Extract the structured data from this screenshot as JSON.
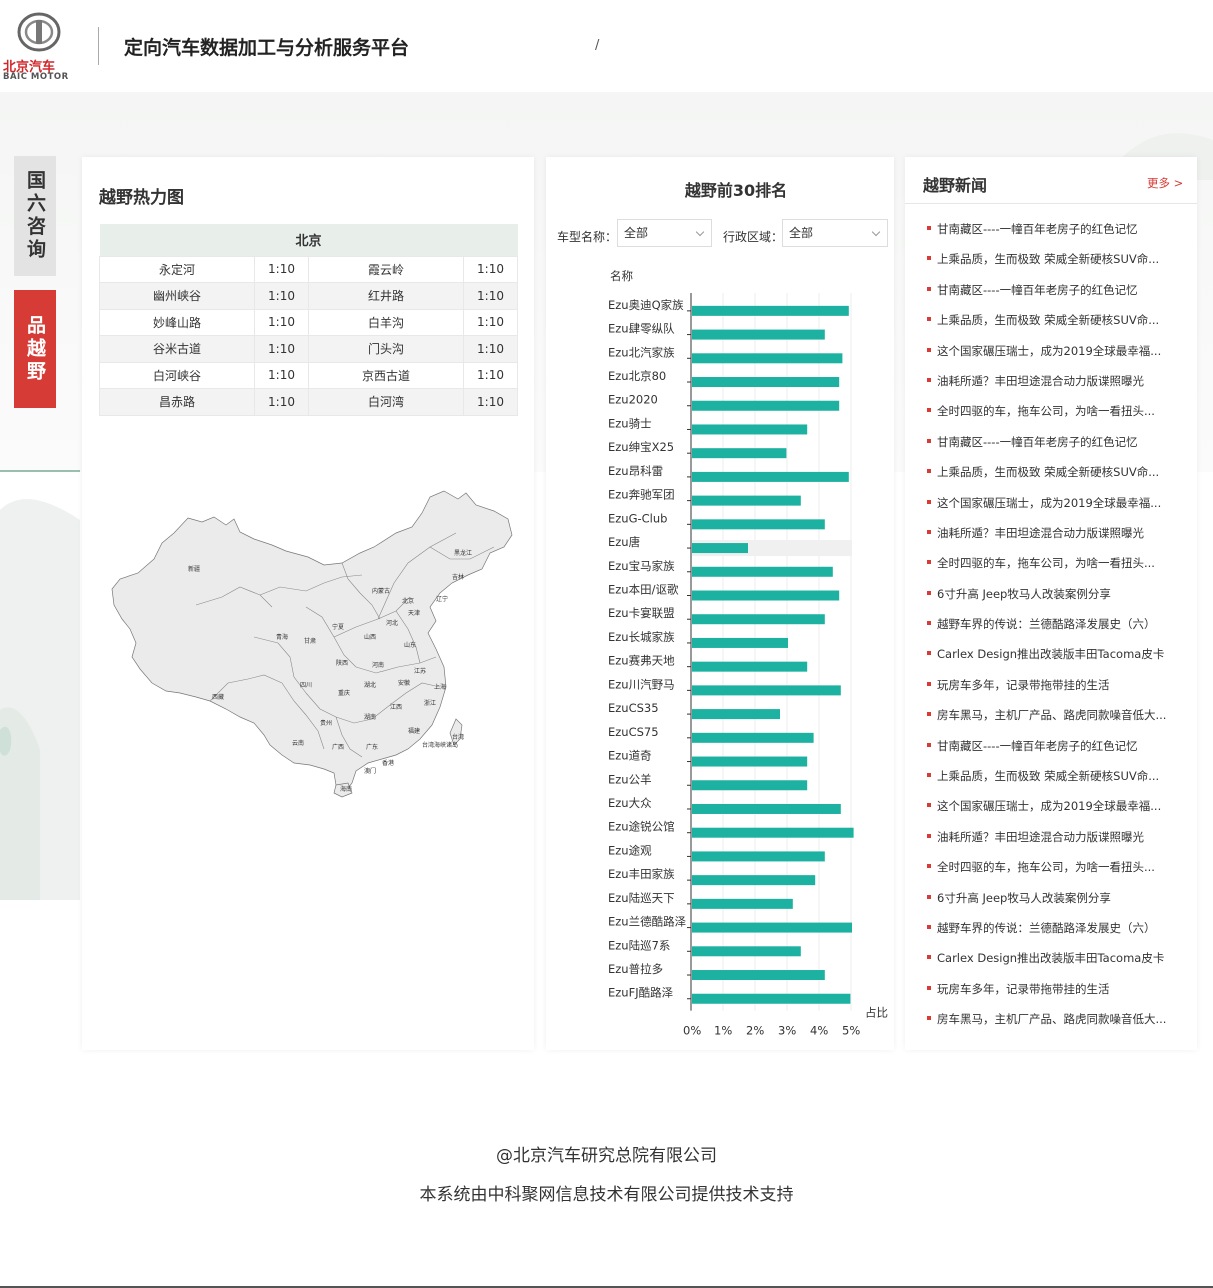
{
  "header": {
    "logo_cn": "北京汽车",
    "logo_en": "BAIC MOTOR",
    "title": "定向汽车数据加工与分析服务平台",
    "breadcrumb_separator": "/"
  },
  "side_tabs": [
    {
      "label": "国六咨询",
      "active": false
    },
    {
      "label": "品越野",
      "active": true
    }
  ],
  "heat_panel": {
    "title": "越野热力图",
    "table_header": "北京",
    "rows": [
      {
        "a": "永定河",
        "a_ratio": "1:10",
        "b": "霞云岭",
        "b_ratio": "1:10"
      },
      {
        "a": "幽州峡谷",
        "a_ratio": "1:10",
        "b": "红井路",
        "b_ratio": "1:10"
      },
      {
        "a": "妙峰山路",
        "a_ratio": "1:10",
        "b": "白羊沟",
        "b_ratio": "1:10"
      },
      {
        "a": "谷米古道",
        "a_ratio": "1:10",
        "b": "门头沟",
        "b_ratio": "1:10"
      },
      {
        "a": "白河峡谷",
        "a_ratio": "1:10",
        "b": "京西古道",
        "b_ratio": "1:10"
      },
      {
        "a": "昌赤路",
        "a_ratio": "1:10",
        "b": "白河湾",
        "b_ratio": "1:10"
      }
    ],
    "map_labels": [
      "新疆",
      "西藏",
      "青海",
      "甘肃",
      "内蒙古",
      "黑龙江",
      "吉林",
      "辽宁",
      "北京",
      "天津",
      "河北",
      "山西",
      "宁夏",
      "陕西",
      "山东",
      "河南",
      "江苏",
      "安徽",
      "湖北",
      "上海",
      "四川",
      "重庆",
      "浙江",
      "湖南",
      "江西",
      "贵州",
      "福建",
      "云南",
      "广西",
      "广东",
      "台湾",
      "香港",
      "澳门",
      "海南",
      "台湾海峡诸岛"
    ]
  },
  "ranking_panel": {
    "title": "越野前30排名",
    "filter_model_label": "车型名称：",
    "filter_model_value": "全部",
    "filter_region_label": "行政区域：",
    "filter_region_value": "全部"
  },
  "chart_data": {
    "type": "bar",
    "orientation": "horizontal",
    "ylabel": "名称",
    "xlabel": "占比",
    "x_ticks": [
      "0%",
      "1%",
      "2%",
      "3%",
      "4%",
      "5%"
    ],
    "xlim": [
      0,
      5
    ],
    "bar_color": "#1cb1a0",
    "highlighted_index": 10,
    "categories": [
      "Ezu奥迪Q家族",
      "Ezu肆零纵队",
      "Ezu北汽家族",
      "Ezu北京80",
      "Ezu2020",
      "Ezu骑士",
      "Ezu绅宝X25",
      "Ezu昂科雷",
      "Ezu奔驰军团",
      "EzuG-Club",
      "Ezu唐",
      "Ezu宝马家族",
      "Ezu本田/讴歌",
      "Ezu卡宴联盟",
      "Ezu长城家族",
      "Ezu赛弗天地",
      "Ezu川汽野马",
      "EzuCS35",
      "EzuCS75",
      "Ezu道奇",
      "Ezu公羊",
      "Ezu大众",
      "Ezu途锐公馆",
      "Ezu途观",
      "Ezu丰田家族",
      "Ezu陆巡天下",
      "Ezu兰德酷路泽",
      "Ezu陆巡7系",
      "Ezu普拉多",
      "EzuFJ酷路泽"
    ],
    "values": [
      4.9,
      4.15,
      4.7,
      4.6,
      4.6,
      3.6,
      2.95,
      4.9,
      3.4,
      4.15,
      1.75,
      4.4,
      4.6,
      4.15,
      3.0,
      3.6,
      4.65,
      2.75,
      3.8,
      3.6,
      3.6,
      4.65,
      5.05,
      4.15,
      3.85,
      3.15,
      5.0,
      3.4,
      4.15,
      4.95
    ]
  },
  "news_panel": {
    "title": "越野新闻",
    "more_label": "更多 >",
    "items": [
      "甘南藏区----一幢百年老房子的红色记忆",
      "上乘品质，生而极致 荣威全新硬核SUV命...",
      "甘南藏区----一幢百年老房子的红色记忆",
      "上乘品质，生而极致 荣威全新硬核SUV命...",
      "这个国家碾压瑞士，成为2019全球最幸福...",
      "油耗所遁？丰田坦途混合动力版谍照曝光",
      "全时四驱的车，拖车公司，为啥一看扭头...",
      "甘南藏区----一幢百年老房子的红色记忆",
      "上乘品质，生而极致 荣威全新硬核SUV命...",
      "这个国家碾压瑞士，成为2019全球最幸福...",
      "油耗所遁？丰田坦途混合动力版谍照曝光",
      "全时四驱的车，拖车公司，为啥一看扭头...",
      "6寸升高 Jeep牧马人改装案例分享",
      "越野车界的传说：兰德酷路泽发展史（六）",
      "Carlex Design推出改装版丰田Tacoma皮卡",
      "玩房车多年，记录带拖带挂的生活",
      "房车黑马，主机厂产品、路虎同款噪音低大...",
      "甘南藏区----一幢百年老房子的红色记忆",
      "上乘品质，生而极致 荣威全新硬核SUV命...",
      "这个国家碾压瑞士，成为2019全球最幸福...",
      "油耗所遁？丰田坦途混合动力版谍照曝光",
      "全时四驱的车，拖车公司，为啥一看扭头...",
      "6寸升高 Jeep牧马人改装案例分享",
      "越野车界的传说：兰德酷路泽发展史（六）",
      "Carlex Design推出改装版丰田Tacoma皮卡",
      "玩房车多年，记录带拖带挂的生活",
      "房车黑马，主机厂产品、路虎同款噪音低大..."
    ]
  },
  "footer": {
    "copyright": "@北京汽车研究总院有限公司",
    "support": "本系统由中科聚网信息技术有限公司提供技术支持"
  }
}
